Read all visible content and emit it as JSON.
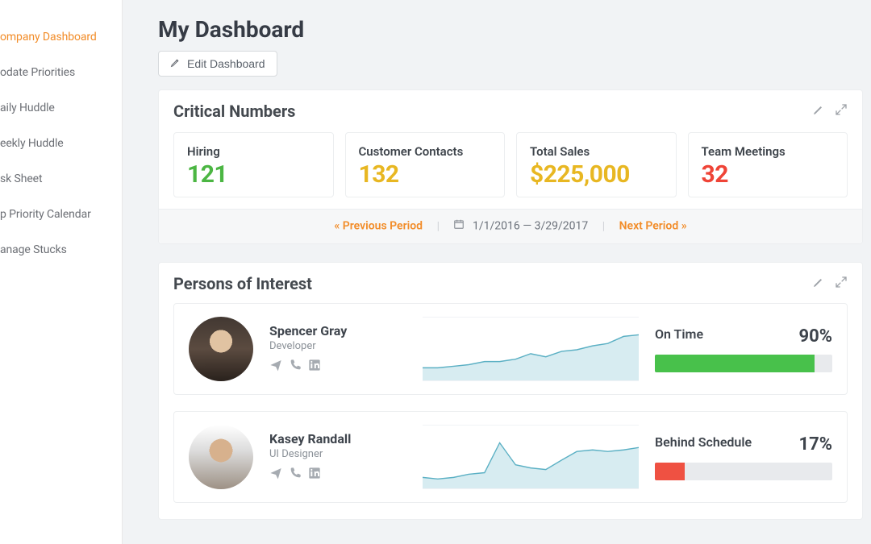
{
  "sidebar": {
    "items": [
      {
        "label": "ompany Dashboard",
        "active": true
      },
      {
        "label": "odate Priorities"
      },
      {
        "label": "aily Huddle"
      },
      {
        "label": "eekly Huddle"
      },
      {
        "label": "sk Sheet"
      },
      {
        "label": "p Priority Calendar"
      },
      {
        "label": "anage Stucks"
      }
    ]
  },
  "header": {
    "title": "My Dashboard",
    "edit_label": "Edit Dashboard"
  },
  "critical": {
    "title": "Critical Numbers",
    "cards": [
      {
        "label": "Hiring",
        "value": "121",
        "color": "green"
      },
      {
        "label": "Customer Contacts",
        "value": "132",
        "color": "yellow"
      },
      {
        "label": "Total Sales",
        "value": "$225,000",
        "color": "yellow"
      },
      {
        "label": "Team Meetings",
        "value": "32",
        "color": "red"
      }
    ],
    "period": {
      "prev_label": "« Previous Period",
      "range": "1/1/2016 — 3/29/2017",
      "next_label": "Next Period »"
    }
  },
  "poi": {
    "title": "Persons of Interest",
    "rows": [
      {
        "name": "Spencer Gray",
        "role": "Developer",
        "metric_label": "On Time",
        "metric_pct": "90%",
        "metric_value": 90,
        "metric_color": "green"
      },
      {
        "name": "Kasey Randall",
        "role": "UI Designer",
        "metric_label": "Behind Schedule",
        "metric_pct": "17%",
        "metric_value": 17,
        "metric_color": "red"
      }
    ]
  },
  "chart_data": [
    {
      "type": "area",
      "title": "Spencer Gray sparkline",
      "x": [
        0,
        1,
        2,
        3,
        4,
        5,
        6,
        7,
        8,
        9,
        10,
        11,
        12,
        13,
        14
      ],
      "values": [
        18,
        18,
        20,
        22,
        26,
        26,
        28,
        34,
        30,
        36,
        38,
        42,
        44,
        50,
        52
      ],
      "ylim": [
        0,
        60
      ]
    },
    {
      "type": "area",
      "title": "Kasey Randall sparkline",
      "x": [
        0,
        1,
        2,
        3,
        4,
        5,
        6,
        7,
        8,
        9,
        10,
        11,
        12,
        13,
        14
      ],
      "values": [
        14,
        12,
        14,
        18,
        20,
        44,
        24,
        22,
        20,
        30,
        38,
        40,
        38,
        40,
        42
      ],
      "ylim": [
        0,
        60
      ]
    }
  ]
}
